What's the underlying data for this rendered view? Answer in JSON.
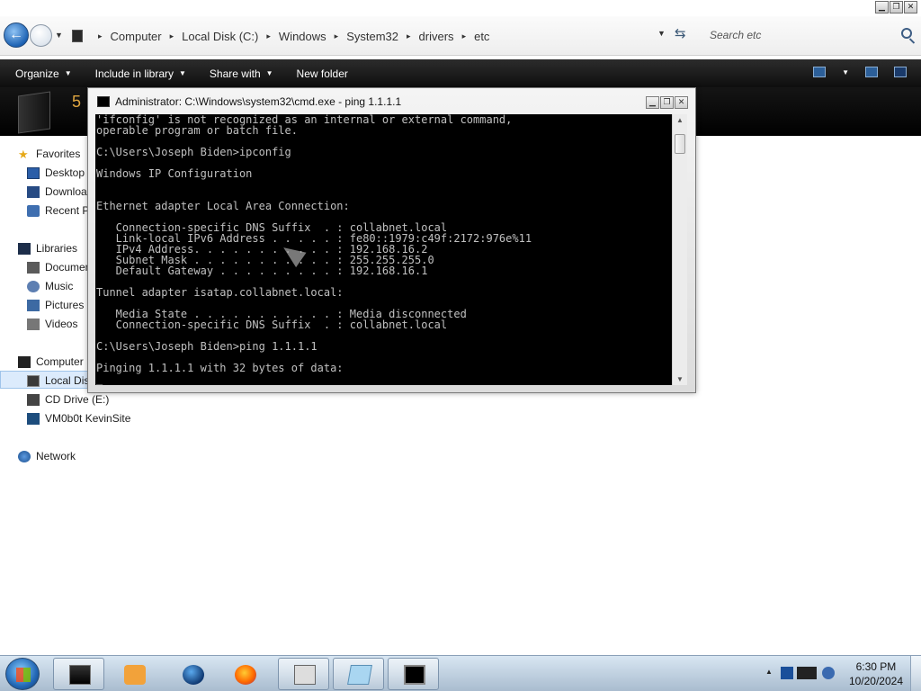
{
  "address_bar": {
    "crumbs": [
      "Computer",
      "Local Disk (C:)",
      "Windows",
      "System32",
      "drivers",
      "etc"
    ],
    "search_placeholder": "Search etc"
  },
  "toolbar": {
    "organize": "Organize",
    "include_in_library": "Include in library",
    "share_with": "Share with",
    "new_folder": "New folder"
  },
  "header": {
    "item_count": "5"
  },
  "nav_pane": {
    "favorites": "Favorites",
    "desktop": "Desktop",
    "downloads": "Downloads",
    "recent": "Recent Places",
    "libraries": "Libraries",
    "documents": "Documents",
    "music": "Music",
    "pictures": "Pictures",
    "videos": "Videos",
    "computer": "Computer",
    "local_disk": "Local Disk (C:)",
    "cd_drive": "CD Drive (E:)",
    "network_drive": "VM0b0t KevinSite",
    "network": "Network"
  },
  "cmd": {
    "title": "Administrator: C:\\Windows\\system32\\cmd.exe - ping  1.1.1.1",
    "output": "'ifconfig' is not recognized as an internal or external command,\noperable program or batch file.\n\nC:\\Users\\Joseph Biden>ipconfig\n\nWindows IP Configuration\n\n\nEthernet adapter Local Area Connection:\n\n   Connection-specific DNS Suffix  . : collabnet.local\n   Link-local IPv6 Address . . . . . : fe80::1979:c49f:2172:976e%11\n   IPv4 Address. . . . . . . . . . . : 192.168.16.2\n   Subnet Mask . . . . . . . . . . . : 255.255.255.0\n   Default Gateway . . . . . . . . . : 192.168.16.1\n\nTunnel adapter isatap.collabnet.local:\n\n   Media State . . . . . . . . . . . : Media disconnected\n   Connection-specific DNS Suffix  . : collabnet.local\n\nC:\\Users\\Joseph Biden>ping 1.1.1.1\n\nPinging 1.1.1.1 with 32 bytes of data:\n_"
  },
  "taskbar": {
    "time": "6:30 PM",
    "date": "10/20/2024"
  }
}
